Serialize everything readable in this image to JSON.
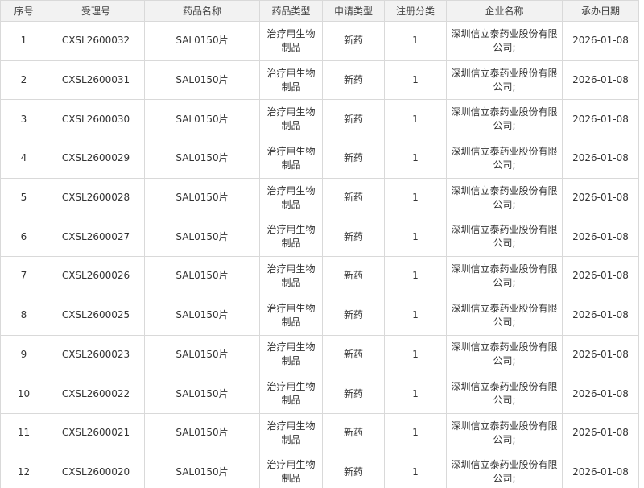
{
  "table": {
    "headers": [
      "序号",
      "受理号",
      "药品名称",
      "药品类型",
      "申请类型",
      "注册分类",
      "企业名称",
      "承办日期"
    ],
    "rows": [
      [
        "1",
        "CXSL2600032",
        "SAL0150片",
        "治疗用生物制品",
        "新药",
        "1",
        "深圳信立泰药业股份有限公司;",
        "2026-01-08"
      ],
      [
        "2",
        "CXSL2600031",
        "SAL0150片",
        "治疗用生物制品",
        "新药",
        "1",
        "深圳信立泰药业股份有限公司;",
        "2026-01-08"
      ],
      [
        "3",
        "CXSL2600030",
        "SAL0150片",
        "治疗用生物制品",
        "新药",
        "1",
        "深圳信立泰药业股份有限公司;",
        "2026-01-08"
      ],
      [
        "4",
        "CXSL2600029",
        "SAL0150片",
        "治疗用生物制品",
        "新药",
        "1",
        "深圳信立泰药业股份有限公司;",
        "2026-01-08"
      ],
      [
        "5",
        "CXSL2600028",
        "SAL0150片",
        "治疗用生物制品",
        "新药",
        "1",
        "深圳信立泰药业股份有限公司;",
        "2026-01-08"
      ],
      [
        "6",
        "CXSL2600027",
        "SAL0150片",
        "治疗用生物制品",
        "新药",
        "1",
        "深圳信立泰药业股份有限公司;",
        "2026-01-08"
      ],
      [
        "7",
        "CXSL2600026",
        "SAL0150片",
        "治疗用生物制品",
        "新药",
        "1",
        "深圳信立泰药业股份有限公司;",
        "2026-01-08"
      ],
      [
        "8",
        "CXSL2600025",
        "SAL0150片",
        "治疗用生物制品",
        "新药",
        "1",
        "深圳信立泰药业股份有限公司;",
        "2026-01-08"
      ],
      [
        "9",
        "CXSL2600023",
        "SAL0150片",
        "治疗用生物制品",
        "新药",
        "1",
        "深圳信立泰药业股份有限公司;",
        "2026-01-08"
      ],
      [
        "10",
        "CXSL2600022",
        "SAL0150片",
        "治疗用生物制品",
        "新药",
        "1",
        "深圳信立泰药业股份有限公司;",
        "2026-01-08"
      ],
      [
        "11",
        "CXSL2600021",
        "SAL0150片",
        "治疗用生物制品",
        "新药",
        "1",
        "深圳信立泰药业股份有限公司;",
        "2026-01-08"
      ],
      [
        "12",
        "CXSL2600020",
        "SAL0150片",
        "治疗用生物制品",
        "新药",
        "1",
        "深圳信立泰药业股份有限公司;",
        "2026-01-08"
      ]
    ]
  }
}
